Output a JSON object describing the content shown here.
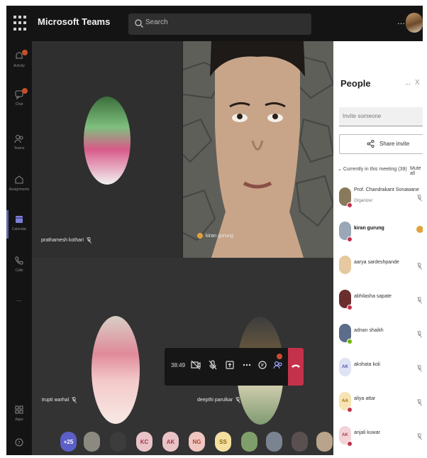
{
  "app": {
    "title": "Microsoft Teams",
    "search_placeholder": "Search",
    "more_label": "...",
    "accent": "#6264a7",
    "danger": "#c4314b"
  },
  "rail": {
    "items": [
      {
        "label": "Activity",
        "icon": "bell-icon",
        "badge": true
      },
      {
        "label": "Chat",
        "icon": "chat-icon",
        "badge": true
      },
      {
        "label": "Teams",
        "icon": "teams-icon",
        "badge": false
      },
      {
        "label": "Assignments",
        "icon": "assignments-icon",
        "badge": false
      },
      {
        "label": "Calendar",
        "icon": "calendar-icon",
        "badge": false,
        "active": true
      },
      {
        "label": "Calls",
        "icon": "phone-icon",
        "badge": false
      },
      {
        "label": "...",
        "icon": "more-icon",
        "badge": false
      }
    ],
    "bottom": [
      {
        "label": "Apps",
        "icon": "apps-icon"
      },
      {
        "label": "",
        "icon": "help-icon"
      }
    ]
  },
  "stage": {
    "tiles": [
      {
        "name": "prathamesh kothari"
      },
      {
        "name": "kiran gurung"
      },
      {
        "name": "trupti warhal"
      },
      {
        "name": "deepthi parulkar"
      }
    ],
    "controls": {
      "timer": "38:49",
      "buttons": [
        "camera-off-icon",
        "mic-off-icon",
        "share-screen-icon",
        "more-icon",
        "chat-icon",
        "people-icon",
        "hang-up-icon"
      ],
      "people_badge": "3"
    },
    "strip": [
      {
        "label": "+25",
        "bg": "#5b5fc7",
        "fg": "#ffffff"
      },
      {
        "label": "",
        "bg": "#8c8a80",
        "fg": "#ffffff"
      },
      {
        "label": "",
        "bg": "#3c3c3c",
        "fg": "#ffffff"
      },
      {
        "label": "KC",
        "bg": "#e9c3c8",
        "fg": "#a1394a"
      },
      {
        "label": "AK",
        "bg": "#e9c3c8",
        "fg": "#a1394a"
      },
      {
        "label": "NG",
        "bg": "#f0c6c0",
        "fg": "#b04a3a"
      },
      {
        "label": "SS",
        "bg": "#f3dfa0",
        "fg": "#8a6a10"
      },
      {
        "label": "",
        "bg": "#7f9f6a",
        "fg": "#ffffff"
      },
      {
        "label": "",
        "bg": "#7a8390",
        "fg": "#ffffff"
      },
      {
        "label": "",
        "bg": "#5a5050",
        "fg": "#ffffff"
      },
      {
        "label": "",
        "bg": "#b8a48a",
        "fg": "#ffffff"
      }
    ]
  },
  "people": {
    "title": "People",
    "more": "...",
    "close": "X",
    "invite_placeholder": "Invite someone",
    "share_label": "Share invite",
    "section_header": "Currently in this meeting (39)",
    "mute_all": "Mute all",
    "participants": [
      {
        "name": "Prof. Chandrakant Sonawane",
        "sub": "Organizer",
        "initials": "",
        "av_bg": "#8a7a5c",
        "av_fg": "#fff",
        "status": "#c4314b",
        "bold": false,
        "state": "muted"
      },
      {
        "name": "kiran gurung",
        "sub": "",
        "initials": "",
        "av_bg": "#9aa7b7",
        "av_fg": "#fff",
        "status": "#c4314b",
        "bold": true,
        "state": "hand"
      },
      {
        "name": "aarya sardeshpande",
        "sub": "",
        "initials": "",
        "av_bg": "#e6c9a0",
        "av_fg": "#fff",
        "status": "",
        "bold": false,
        "state": "muted"
      },
      {
        "name": "abhilasha sapate",
        "sub": "",
        "initials": "",
        "av_bg": "#6b2e2e",
        "av_fg": "#fff",
        "status": "#c4314b",
        "bold": false,
        "state": "muted"
      },
      {
        "name": "adnan shaikh",
        "sub": "",
        "initials": "",
        "av_bg": "#5b6d8a",
        "av_fg": "#fff",
        "status": "#6bb700",
        "bold": false,
        "state": "muted"
      },
      {
        "name": "akshata koli",
        "sub": "",
        "initials": "AK",
        "av_bg": "#dfe3f3",
        "av_fg": "#4f52b2",
        "status": "",
        "bold": false,
        "state": "muted"
      },
      {
        "name": "aliya attar",
        "sub": "",
        "initials": "AA",
        "av_bg": "#f7e3b3",
        "av_fg": "#9a6a00",
        "status": "#c4314b",
        "bold": false,
        "state": "muted"
      },
      {
        "name": "anjali kuwar",
        "sub": "",
        "initials": "AK",
        "av_bg": "#f4d3d8",
        "av_fg": "#a1394a",
        "status": "#c4314b",
        "bold": false,
        "state": "muted"
      }
    ]
  }
}
